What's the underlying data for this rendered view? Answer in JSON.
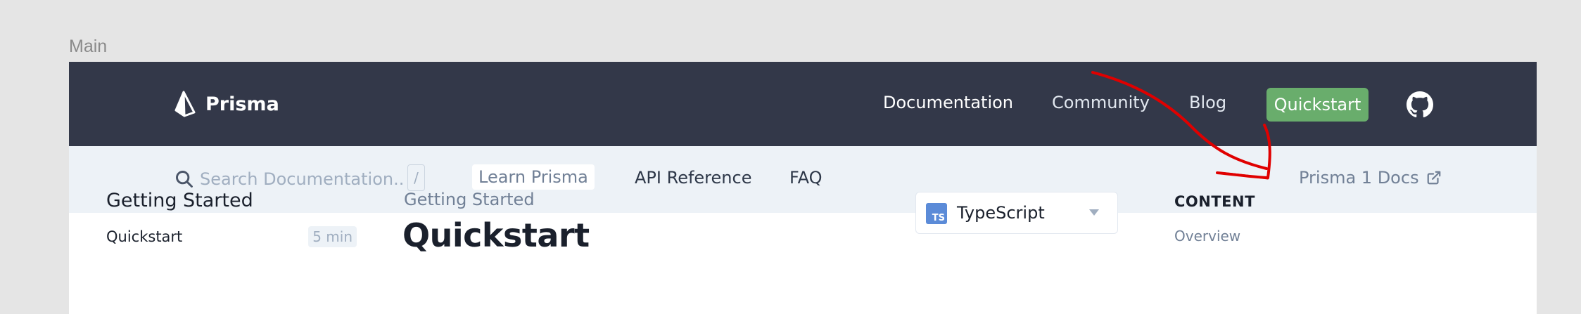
{
  "frame": {
    "label": "Main"
  },
  "header": {
    "brand": "Prisma",
    "nav": [
      {
        "label": "Documentation",
        "active": true
      },
      {
        "label": "Community"
      },
      {
        "label": "Blog"
      }
    ],
    "cta": "Quickstart",
    "github_icon": "github-icon"
  },
  "subnav": {
    "search": {
      "placeholder": "Search Documentation...",
      "shortcut": "/"
    },
    "links": [
      "Learn Prisma",
      "API Reference",
      "FAQ"
    ],
    "selected": "Learn Prisma",
    "external": {
      "label": "Prisma 1 Docs",
      "icon": "external-link-icon"
    }
  },
  "sidebar": {
    "heading": "Getting Started",
    "items": [
      {
        "label": "Quickstart",
        "time": "5 min"
      }
    ]
  },
  "main": {
    "breadcrumb": "Getting Started",
    "title": "Quickstart",
    "language": {
      "badge": "TS",
      "selected": "TypeScript"
    }
  },
  "toc": {
    "heading": "CONTENT",
    "items": [
      "Overview"
    ]
  },
  "colors": {
    "header_bg": "#333849",
    "subnav_bg": "#edf2f7",
    "cta_bg": "#69ad6c",
    "annotation": "#e00000"
  }
}
